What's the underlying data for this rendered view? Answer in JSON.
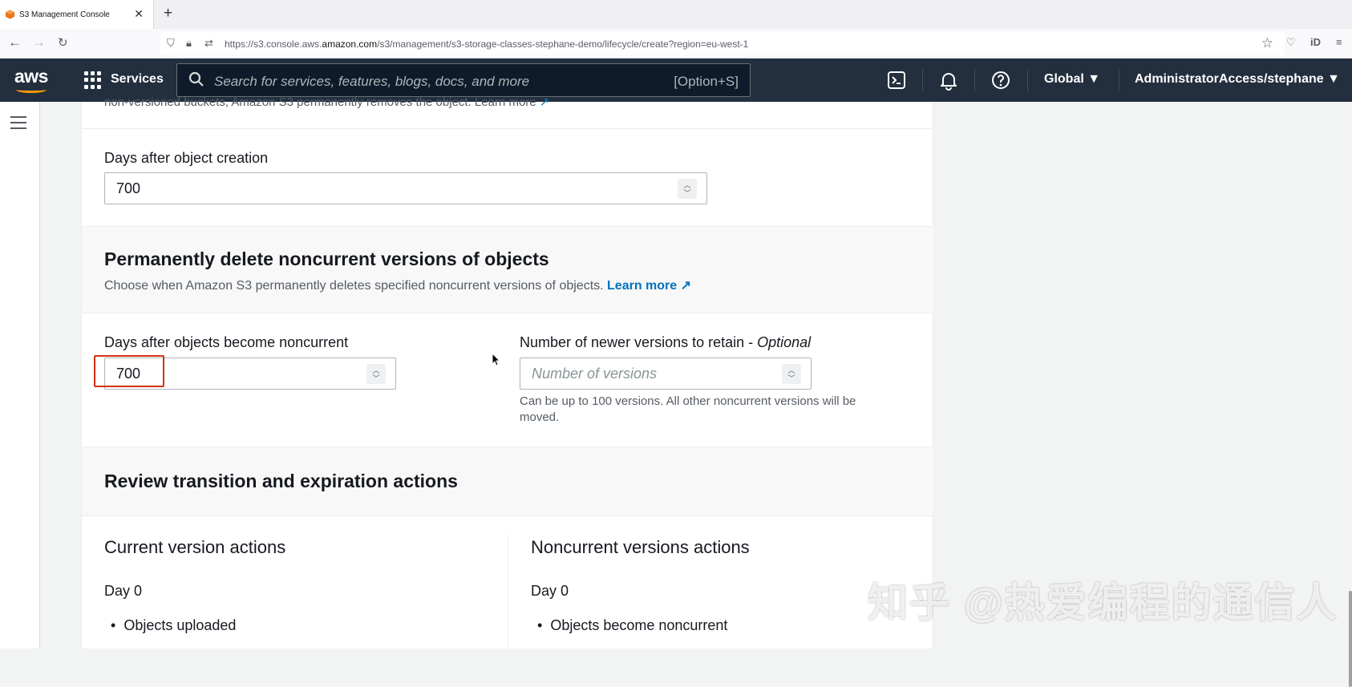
{
  "browser": {
    "tab_title": "S3 Management Console",
    "tab_close": "✕",
    "new_tab": "+",
    "url_prefix": "https://s3.console.aws.",
    "url_domain": "amazon.com",
    "url_path": "/s3/management/s3-storage-classes-stephane-demo/lifecycle/create?region=eu-west-1"
  },
  "aws_nav": {
    "logo": "aws",
    "services_label": "Services",
    "search_placeholder": "Search for services, features, blogs, docs, and more",
    "search_shortcut": "[Option+S]",
    "region_label": "Global ▼",
    "account_label": "AdministratorAccess/stephane ▼"
  },
  "partial_top": {
    "text": "non-versioned buckets, Amazon S3 permanently removes the object. Learn more"
  },
  "expire_section": {
    "days_label": "Days after object creation",
    "days_value": "700"
  },
  "noncurrent_section": {
    "title": "Permanently delete noncurrent versions of objects",
    "description": "Choose when Amazon S3 permanently deletes specified noncurrent versions of objects.",
    "learn_more": "Learn more",
    "days_label": "Days after objects become noncurrent",
    "days_value": "700",
    "versions_label": "Number of newer versions to retain - ",
    "versions_label_optional": "Optional",
    "versions_placeholder": "Number of versions",
    "versions_help": "Can be up to 100 versions. All other noncurrent versions will be moved."
  },
  "review_section": {
    "title": "Review transition and expiration actions",
    "current": {
      "title": "Current version actions",
      "day": "Day 0",
      "item": "Objects uploaded"
    },
    "noncurrent": {
      "title": "Noncurrent versions actions",
      "day": "Day 0",
      "item": "Objects become noncurrent"
    }
  },
  "watermark": "知乎 @热爱编程的通信人",
  "colors": {
    "aws_nav_bg": "#232f3e",
    "aws_orange": "#ff9900",
    "link_blue": "#0073bb",
    "highlight_red": "#d13212"
  }
}
